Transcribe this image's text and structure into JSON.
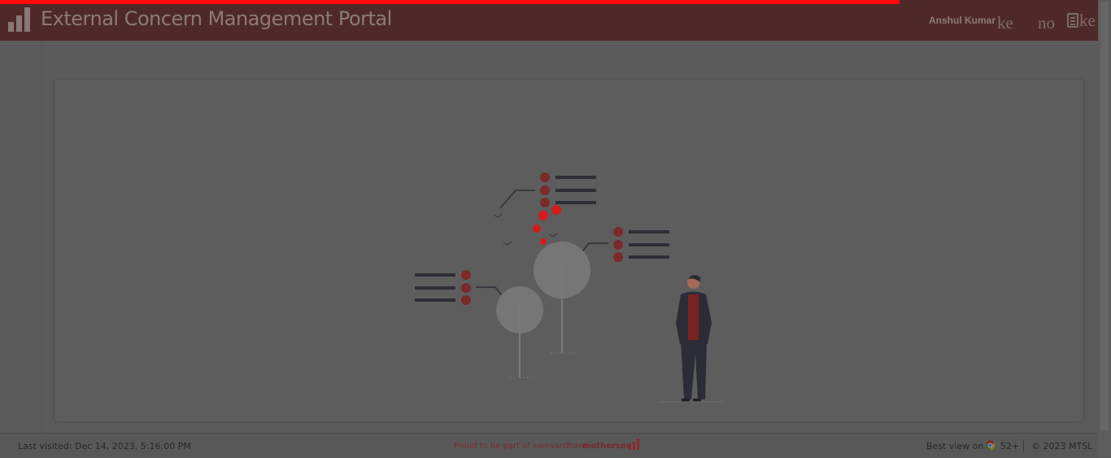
{
  "header": {
    "title": "External Concern Management Portal",
    "user_name": "Anshul Kumar",
    "glyphs": [
      "ke",
      "no",
      "ke"
    ],
    "icons": [
      "bar-chart-logo-icon",
      "calculator-icon"
    ]
  },
  "loading": {
    "progress_percent": 81
  },
  "footer": {
    "last_visited": "Last visited: Dec 14, 2023, 5:16:00 PM",
    "proud_text": "Proud to be part of samvardhana",
    "brand": "motherson",
    "best_view": "Best view on",
    "browser_version": "52+",
    "copyright": "© 2023 MTSL"
  },
  "colors": {
    "header_bg": "#4f2929",
    "progress": "#ff0a0a",
    "overlay_bg": "#5b5b5b",
    "accent": "#8a2a2a"
  }
}
